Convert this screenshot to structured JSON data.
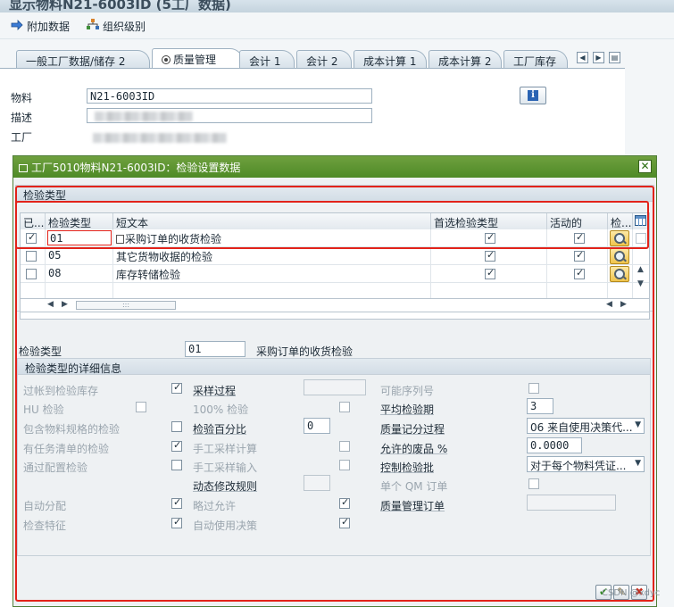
{
  "window": {
    "title_fragment": "显示物料N21-6003ID (5工厂数据)"
  },
  "toolbar": {
    "additional_data": "附加数据",
    "org_levels": "组织级别"
  },
  "tabs": [
    {
      "label": "一般工厂数据/储存 2"
    },
    {
      "label": "质量管理"
    },
    {
      "label": "会计 1"
    },
    {
      "label": "会计 2"
    },
    {
      "label": "成本计算 1"
    },
    {
      "label": "成本计算 2"
    },
    {
      "label": "工厂库存"
    }
  ],
  "header": {
    "material_label": "物料",
    "material_value": "N21-6003ID",
    "desc_label": "描述",
    "plant_label": "工厂"
  },
  "dialog": {
    "title": "工厂5010物料N21-6003ID：检验设置数据",
    "group_title": "检验类型",
    "columns": {
      "active_short": "已...",
      "type": "检验类型",
      "short_text": "短文本",
      "preferred": "首选检验类型",
      "active": "活动的",
      "check": "检..."
    },
    "rows": [
      {
        "type": "01",
        "text": "采购订单的收货检验",
        "selected": true,
        "preferred": true,
        "active": true
      },
      {
        "type": "05",
        "text": "其它货物收据的检验",
        "selected": false,
        "preferred": true,
        "active": true
      },
      {
        "type": "08",
        "text": "库存转储检验",
        "selected": false,
        "preferred": true,
        "active": true
      }
    ],
    "scroll_dots": ":::",
    "insp_type_label": "检验类型",
    "insp_type_value": "01",
    "insp_type_text": "采购订单的收货检验",
    "details_title": "检验类型的详细信息",
    "col1": [
      {
        "label": "过帐到检验库存",
        "checked": true
      },
      {
        "label": "HU 检验",
        "checked": false
      },
      {
        "label": "包含物料规格的检验",
        "checked": false
      },
      {
        "label": "有任务清单的检验",
        "checked": true
      },
      {
        "label": "通过配置检验",
        "checked": false
      },
      {
        "label": "自动分配",
        "checked": true
      },
      {
        "label": "检查特征",
        "checked": true
      }
    ],
    "col2": {
      "sampling_proc": "采样过程",
      "pct_100": "100% 检验",
      "insp_pct": "检验百分比",
      "insp_pct_value": "0",
      "manual_sample_calc": "手工采样计算",
      "manual_sample_input": "手工采样输入",
      "dyn_mod_rule": "动态修改规则",
      "skip_allowed": "略过允许",
      "auto_ud": "自动使用决策"
    },
    "col3": {
      "serial_possible": "可能序列号",
      "avg_insp_period": "平均检验期",
      "avg_insp_period_value": "3",
      "qscore_proc": "质量记分过程",
      "qscore_proc_value": "06 来自使用决策代...",
      "allowed_scrap": "允许的废品 %",
      "allowed_scrap_value": "0.0000",
      "control_lot": "控制检验批",
      "control_lot_value": "对于每个物料凭证...",
      "single_qm_order": "单个 QM 订单",
      "qm_order": "质量管理订单"
    }
  },
  "watermark": "CSDN @xdyc"
}
